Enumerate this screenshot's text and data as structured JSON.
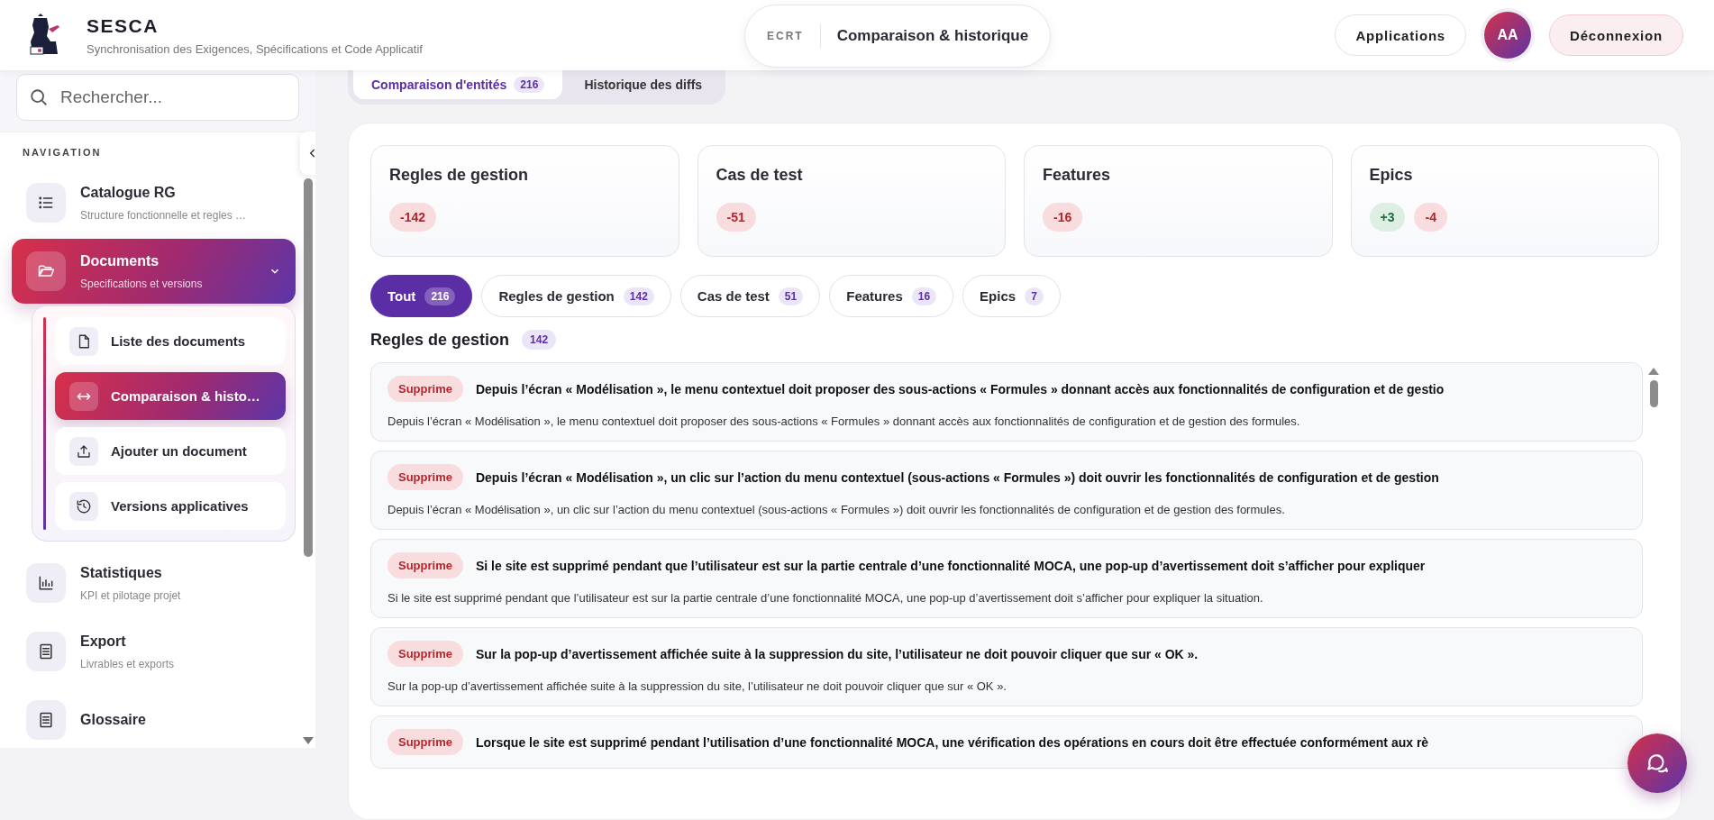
{
  "header": {
    "app_name": "SESCA",
    "app_subtitle": "Synchronisation des Exigences, Spécifications et Code Applicatif",
    "breadcrumb": {
      "section": "ECRT",
      "page": "Comparaison & historique"
    },
    "applications_button": "Applications",
    "avatar": "AA",
    "logout_button": "Déconnexion"
  },
  "sidebar": {
    "search": {
      "placeholder": "Rechercher..."
    },
    "nav_heading": "NAVIGATION",
    "items": [
      {
        "label": "Catalogue RG",
        "subtitle": "Structure fonctionnelle et regles …",
        "selected": false
      },
      {
        "label": "Documents",
        "subtitle": "Specifications et versions",
        "selected": true,
        "expanded": true,
        "children": [
          {
            "label": "Liste des documents",
            "selected": false
          },
          {
            "label": "Comparaison & histo…",
            "selected": true
          },
          {
            "label": "Ajouter un document",
            "selected": false
          },
          {
            "label": "Versions applicatives",
            "selected": false
          }
        ]
      },
      {
        "label": "Statistiques",
        "subtitle": "KPI et pilotage projet",
        "selected": false
      },
      {
        "label": "Export",
        "subtitle": "Livrables et exports",
        "selected": false
      },
      {
        "label": "Glossaire",
        "selected": false
      }
    ]
  },
  "top_tabs": [
    {
      "label": "Comparaison d'entités",
      "count": "216",
      "selected": true
    },
    {
      "label": "Historique des diffs",
      "selected": false
    }
  ],
  "stats": [
    {
      "title": "Regles de gestion",
      "deltas": [
        {
          "text": "-142",
          "kind": "removed"
        }
      ]
    },
    {
      "title": "Cas de test",
      "deltas": [
        {
          "text": "-51",
          "kind": "removed"
        }
      ]
    },
    {
      "title": "Features",
      "deltas": [
        {
          "text": "-16",
          "kind": "removed"
        }
      ]
    },
    {
      "title": "Epics",
      "deltas": [
        {
          "text": "+3",
          "kind": "added"
        },
        {
          "text": "-4",
          "kind": "removed"
        }
      ]
    }
  ],
  "filters": [
    {
      "label": "Tout",
      "count": "216",
      "selected": true
    },
    {
      "label": "Regles de gestion",
      "count": "142",
      "selected": false
    },
    {
      "label": "Cas de test",
      "count": "51",
      "selected": false
    },
    {
      "label": "Features",
      "count": "16",
      "selected": false
    },
    {
      "label": "Epics",
      "count": "7",
      "selected": false
    }
  ],
  "section": {
    "title": "Regles de gestion",
    "count": "142"
  },
  "rows": [
    {
      "status": "Supprime",
      "title": "Depuis l’écran « Modélisation », le menu contextuel doit proposer des sous-actions « Formules » donnant accès aux fonctionnalités de configuration et de gestio",
      "description": "Depuis l’écran « Modélisation », le menu contextuel doit proposer des sous-actions « Formules » donnant accès aux fonctionnalités de configuration et de gestion des formules."
    },
    {
      "status": "Supprime",
      "title": "Depuis l’écran « Modélisation », un clic sur l’action du menu contextuel (sous-actions « Formules ») doit ouvrir les fonctionnalités de configuration et de gestion",
      "description": "Depuis l’écran « Modélisation », un clic sur l’action du menu contextuel (sous-actions « Formules ») doit ouvrir les fonctionnalités de configuration et de gestion des formules."
    },
    {
      "status": "Supprime",
      "title": "Si le site est supprimé pendant que l’utilisateur est sur la partie centrale d’une fonctionnalité MOCA, une pop-up d’avertissement doit s’afficher pour expliquer",
      "description": "Si le site est supprimé pendant que l’utilisateur est sur la partie centrale d’une fonctionnalité MOCA, une pop-up d’avertissement doit s’afficher pour expliquer la situation."
    },
    {
      "status": "Supprime",
      "title": "Sur la pop-up d’avertissement affichée suite à la suppression du site, l’utilisateur ne doit pouvoir cliquer que sur « OK ».",
      "description": "Sur la pop-up d’avertissement affichée suite à la suppression du site, l’utilisateur ne doit pouvoir cliquer que sur « OK »."
    },
    {
      "status": "Supprime",
      "title": "Lorsque le site est supprimé pendant l’utilisation d’une fonctionnalité MOCA, une vérification des opérations en cours doit être effectuée conformément aux rè"
    }
  ]
}
